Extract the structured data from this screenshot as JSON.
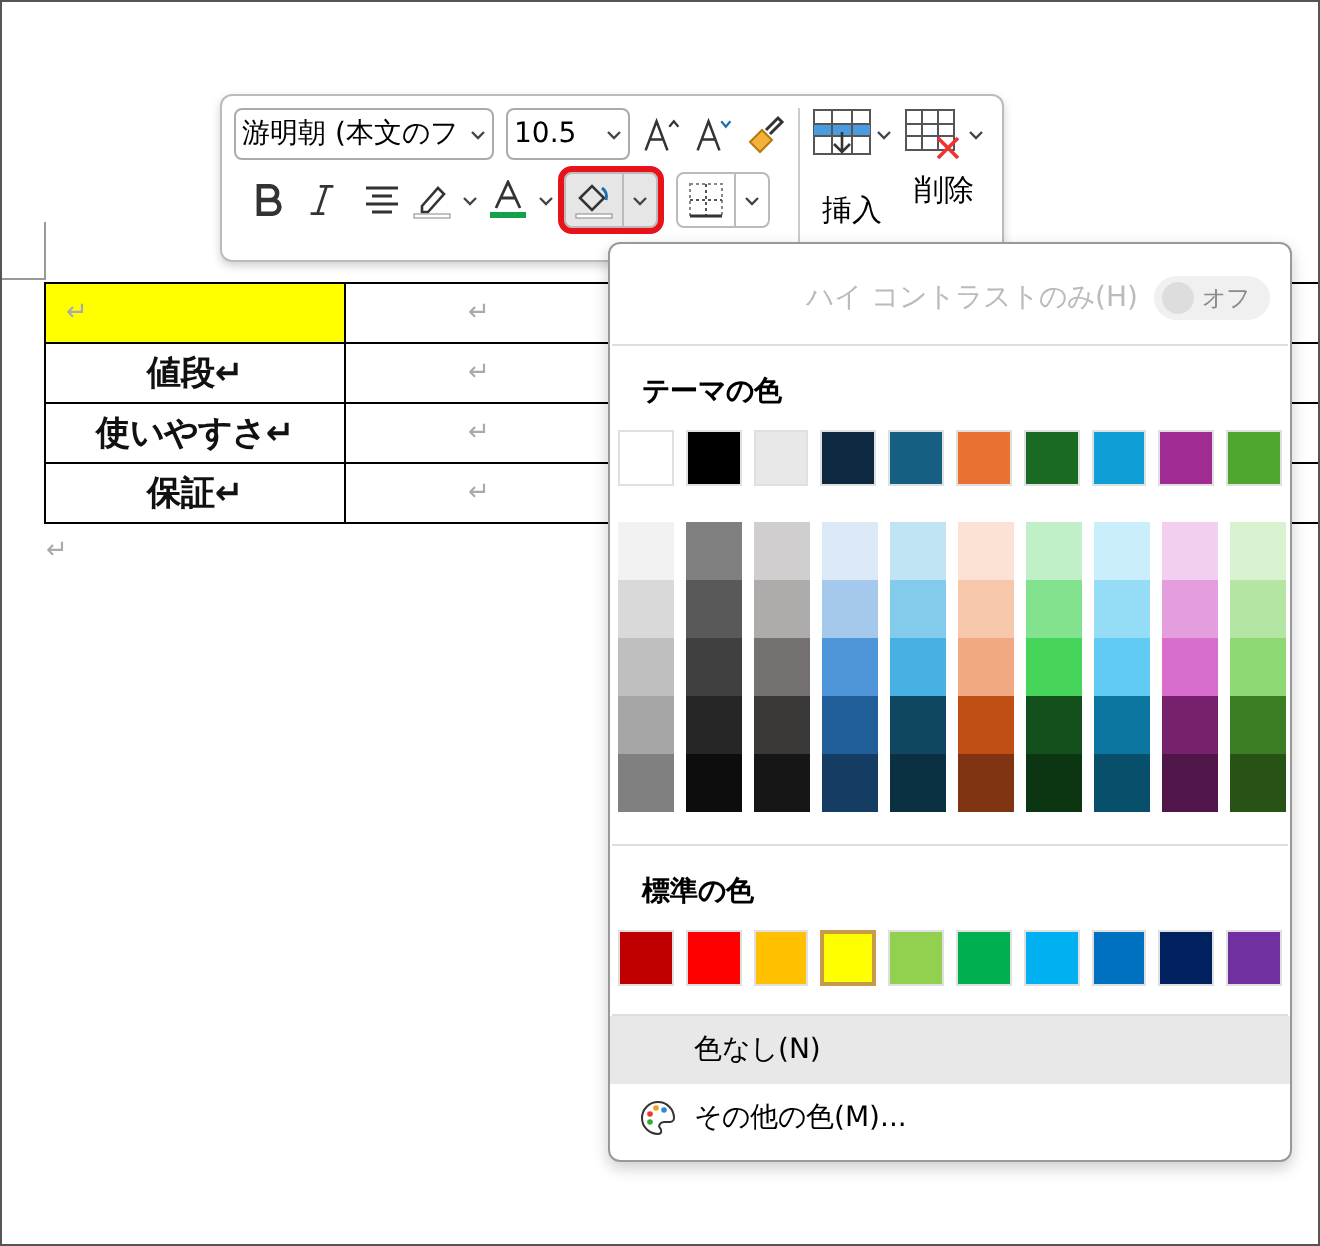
{
  "toolbar": {
    "font_name": "游明朝 (本文のフ",
    "font_size": "10.5",
    "insert_label": "挿入",
    "delete_label": "削除",
    "shading_pressed": true,
    "shading_annotated": true
  },
  "table": {
    "rows": [
      {
        "cells": [
          {
            "text": "↵",
            "shaded": true
          },
          {
            "text": "↵",
            "shaded": false
          },
          {
            "shaded": false
          }
        ]
      },
      {
        "cells": [
          {
            "text": "値段↵",
            "shaded": false
          },
          {
            "text": "↵",
            "shaded": false
          },
          {
            "shaded": false
          }
        ]
      },
      {
        "cells": [
          {
            "text": "使いやすさ↵",
            "shaded": false
          },
          {
            "text": "↵",
            "shaded": false
          },
          {
            "shaded": false
          }
        ]
      },
      {
        "cells": [
          {
            "text": "保証↵",
            "shaded": false
          },
          {
            "text": "↵",
            "shaded": false
          },
          {
            "shaded": false
          }
        ]
      }
    ]
  },
  "paragraph_mark": "↵",
  "color_menu": {
    "high_contrast": {
      "label": "ハイ コントラストのみ(H)",
      "toggle_label": "オフ",
      "on": false,
      "disabled": true
    },
    "theme_title": "テーマの色",
    "theme_colors": [
      {
        "color": "#ffffff"
      },
      {
        "color": "#000000"
      },
      {
        "color": "#e8e8e8"
      },
      {
        "color": "#0e2841"
      },
      {
        "color": "#156082"
      },
      {
        "color": "#e97132"
      },
      {
        "color": "#196b24"
      },
      {
        "color": "#0f9ed5"
      },
      {
        "color": "#a02b93"
      },
      {
        "color": "#4ea72e"
      }
    ],
    "shade_columns": [
      {
        "shades": [
          {
            "color": "#f2f2f2"
          },
          {
            "color": "#d9d9d9"
          },
          {
            "color": "#bfbfbf"
          },
          {
            "color": "#a6a6a6"
          },
          {
            "color": "#808080"
          }
        ]
      },
      {
        "shades": [
          {
            "color": "#808080"
          },
          {
            "color": "#595959"
          },
          {
            "color": "#404040"
          },
          {
            "color": "#262626"
          },
          {
            "color": "#0d0d0d"
          }
        ]
      },
      {
        "shades": [
          {
            "color": "#d0cece"
          },
          {
            "color": "#aeabab"
          },
          {
            "color": "#767171"
          },
          {
            "color": "#3b3838"
          },
          {
            "color": "#171616"
          }
        ]
      },
      {
        "shades": [
          {
            "color": "#dceaf7"
          },
          {
            "color": "#a5c8ed"
          },
          {
            "color": "#4e95d9"
          },
          {
            "color": "#215f9a"
          },
          {
            "color": "#153d63"
          }
        ]
      },
      {
        "shades": [
          {
            "color": "#c1e4f5"
          },
          {
            "color": "#83cbeb"
          },
          {
            "color": "#45b0e1"
          },
          {
            "color": "#0f4761"
          },
          {
            "color": "#0b3041"
          }
        ]
      },
      {
        "shades": [
          {
            "color": "#fbe2d5"
          },
          {
            "color": "#f7c7ac"
          },
          {
            "color": "#f1a983"
          },
          {
            "color": "#c04f15"
          },
          {
            "color": "#803411"
          }
        ]
      },
      {
        "shades": [
          {
            "color": "#c1f0c8"
          },
          {
            "color": "#83e28e"
          },
          {
            "color": "#47d45a"
          },
          {
            "color": "#124f1a"
          },
          {
            "color": "#0c3512"
          }
        ]
      },
      {
        "shades": [
          {
            "color": "#caeefb"
          },
          {
            "color": "#95dcf7"
          },
          {
            "color": "#61cbf3"
          },
          {
            "color": "#0b76a0"
          },
          {
            "color": "#074f6a"
          }
        ]
      },
      {
        "shades": [
          {
            "color": "#f2cfee"
          },
          {
            "color": "#e59edd"
          },
          {
            "color": "#d86dcd"
          },
          {
            "color": "#77206d"
          },
          {
            "color": "#501549"
          }
        ]
      },
      {
        "shades": [
          {
            "color": "#d9f2d0"
          },
          {
            "color": "#b4e5a2"
          },
          {
            "color": "#8ed973"
          },
          {
            "color": "#3a7d22"
          },
          {
            "color": "#275317"
          }
        ]
      }
    ],
    "standard_title": "標準の色",
    "standard_colors": [
      {
        "color": "#c00000",
        "selected": false
      },
      {
        "color": "#ff0000",
        "selected": false
      },
      {
        "color": "#ffc000",
        "selected": false
      },
      {
        "color": "#ffff00",
        "selected": true
      },
      {
        "color": "#92d050",
        "selected": false
      },
      {
        "color": "#00b050",
        "selected": false
      },
      {
        "color": "#00b0f0",
        "selected": false
      },
      {
        "color": "#0070c0",
        "selected": false
      },
      {
        "color": "#002060",
        "selected": false
      },
      {
        "color": "#7030a0",
        "selected": false
      }
    ],
    "items": [
      {
        "kind": "none",
        "label": "色なし(N)",
        "selected": true
      },
      {
        "kind": "more",
        "label": "その他の色(M)...",
        "selected": false
      }
    ]
  }
}
